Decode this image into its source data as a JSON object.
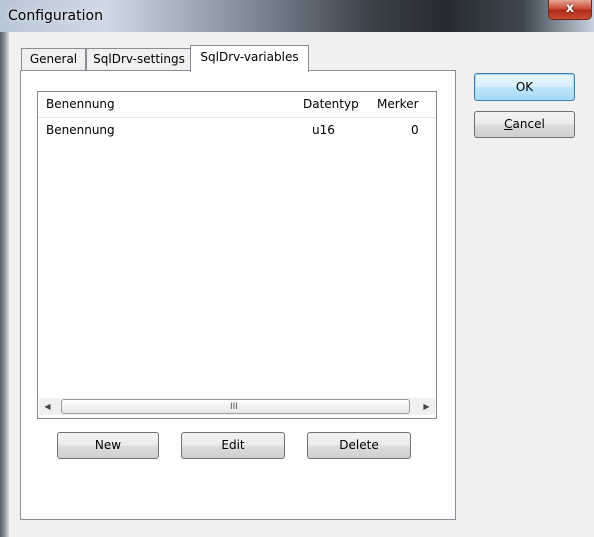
{
  "window": {
    "title": "Configuration",
    "close_glyph": "x"
  },
  "tabs": [
    {
      "label": "General",
      "active": false
    },
    {
      "label": "SqlDrv-settings",
      "active": false
    },
    {
      "label": "SqlDrv-variables",
      "active": true
    }
  ],
  "variables_list": {
    "columns": [
      "Benennung",
      "Datentyp",
      "Merker"
    ],
    "rows": [
      {
        "Benennung": "Benennung",
        "Datentyp": "u16",
        "Merker": "0"
      }
    ],
    "scrollbar": {
      "left_arrow": "◀",
      "right_arrow": "▶",
      "grip": "III"
    }
  },
  "list_buttons": {
    "new_label": "New",
    "edit_label": "Edit",
    "delete_label": "Delete"
  },
  "dialog_buttons": {
    "ok_label": "OK",
    "cancel_mnemonic": "C",
    "cancel_rest": "ancel"
  },
  "colors": {
    "default_button_border": "#3c7fb1",
    "close_button": "#c8442d",
    "panel_border": "#898c95"
  }
}
